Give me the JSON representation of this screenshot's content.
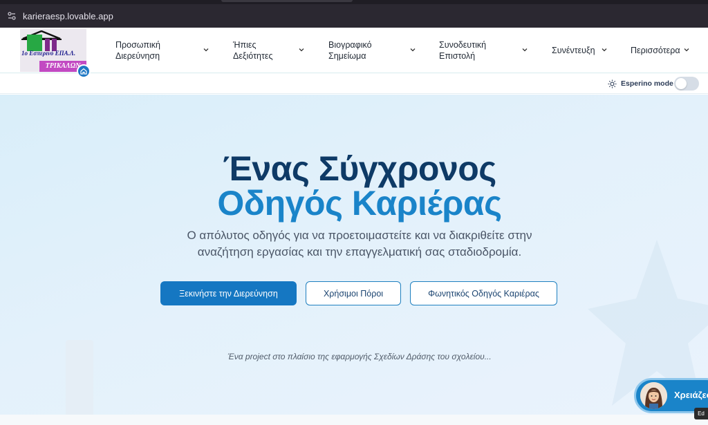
{
  "browser": {
    "url": "karieraesp.lovable.app"
  },
  "logo": {
    "school_name": "1ο Εσπερινό ΕΠΑ.Λ.",
    "city": "ΤΡΙΚΑΛΩΝ"
  },
  "nav": {
    "items": [
      {
        "label_line1": "Προσωπική",
        "label_line2": "Διερεύνηση"
      },
      {
        "label_line1": "Ήπιες",
        "label_line2": "Δεξιότητες"
      },
      {
        "label_line1": "Βιογραφικό",
        "label_line2": "Σημείωμα"
      },
      {
        "label_line1": "Συνοδευτική",
        "label_line2": "Επιστολή"
      },
      {
        "label_line1": "Συνέντευξη",
        "label_line2": ""
      },
      {
        "label_line1": "Περισσότερα",
        "label_line2": ""
      }
    ]
  },
  "mode": {
    "label": "Esperino mode",
    "enabled": false
  },
  "hero": {
    "title_line1": "Ένας Σύγχρονος",
    "title_line2": "Οδηγός Καριέρας",
    "subtitle_line1": "Ο απόλυτος οδηγός για να προετοιμαστείτε και να διακριθείτε στην",
    "subtitle_line2": "αναζήτηση εργασίας και την επαγγελματική σας σταδιοδρομία.",
    "primary_button": "Ξεκινήστε την Διερεύνηση",
    "resources_button": "Χρήσιμοι Πόροι",
    "voice_button": "Φωνητικός Οδηγός Καριέρας",
    "footer_note": "Ένα project στο πλαίσιο της εφαρμογής Σχεδίων Δράσης του σχολείου..."
  },
  "chat": {
    "label": "Χρειάζεσ"
  },
  "edit_badge": "Ed",
  "colors": {
    "primary": "#1577c2",
    "title_dark": "#0e3a66",
    "title_accent": "#1a84c9",
    "hero_bg": "#d9eef9"
  }
}
